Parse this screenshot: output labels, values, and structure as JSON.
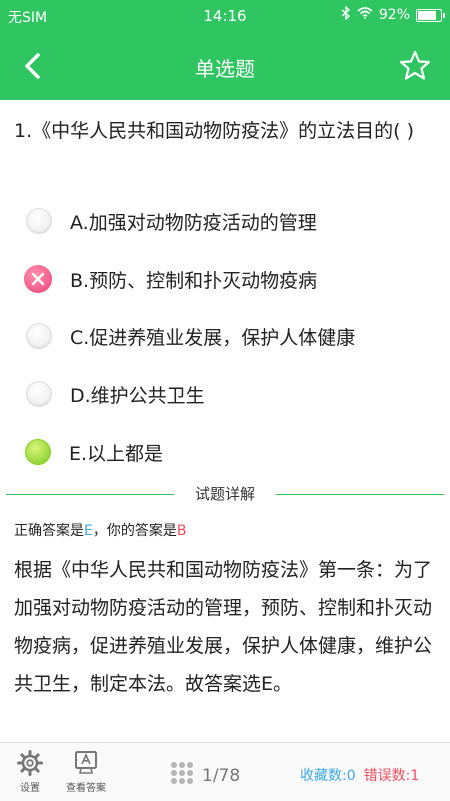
{
  "status_bar": {
    "carrier": "无SIM",
    "time": "14:16",
    "battery": "92%",
    "battery_level": 0.92
  },
  "nav": {
    "title": "单选题",
    "back_icon": "chevron-left-icon",
    "favorite_icon": "star-outline-icon"
  },
  "question": {
    "text": "1.《中华人民共和国动物防疫法》的立法目的( )"
  },
  "options": [
    {
      "label": "A.加强对动物防疫活动的管理",
      "state": "unselected"
    },
    {
      "label": "B.预防、控制和扑灭动物疫病",
      "state": "wrong"
    },
    {
      "label": "C.促进养殖业发展，保护人体健康",
      "state": "unselected"
    },
    {
      "label": "D.维护公共卫生",
      "state": "unselected"
    },
    {
      "label": "E.以上都是",
      "state": "correct"
    }
  ],
  "detail": {
    "section_title": "试题详解",
    "correct_prefix": "正确答案是",
    "correct_answer": "E",
    "your_prefix": "，你的答案是",
    "your_answer": "B",
    "explanation": "根据《中华人民共和国动物防疫法》第一条：为了加强对动物防疫活动的管理，预防、控制和扑灭动物疫病，促进养殖业发展，保护人体健康，维护公共卫生，制定本法。故答案选E。"
  },
  "bottom_bar": {
    "settings_label": "设置",
    "view_answer_label": "查看答案",
    "page": "1/78",
    "favorites_label": "收藏数:0",
    "errors_label": "错误数:1"
  },
  "colors": {
    "primary": "#2fc561",
    "correct_text": "#3fa9e6",
    "wrong_text": "#ef4d5c",
    "wrong_mark": "#f0457a",
    "correct_mark": "#74c51a"
  }
}
